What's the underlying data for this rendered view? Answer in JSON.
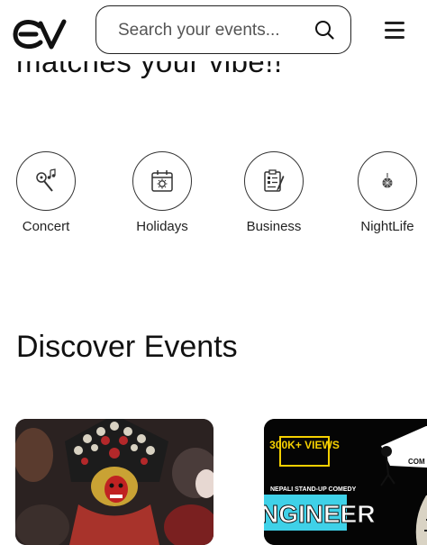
{
  "header": {
    "logo_text": "EV",
    "search": {
      "placeholder": "Search your events...",
      "value": ""
    },
    "icons": {
      "search": "search-icon",
      "menu": "hamburger-menu-icon"
    }
  },
  "hero": {
    "text": "matches your vibe!!"
  },
  "categories": [
    {
      "label": "Concert",
      "icon": "guitar-music-icon"
    },
    {
      "label": "Holidays",
      "icon": "calendar-sun-icon"
    },
    {
      "label": "Business",
      "icon": "clipboard-checklist-icon"
    },
    {
      "label": "NightLife",
      "icon": "disco-ball-icon"
    }
  ],
  "discover": {
    "title": "Discover Events",
    "cards": [
      {
        "image": "festival-mask-photo"
      },
      {
        "image": "standup-comedy-poster",
        "badge": "300K+ VIEWS",
        "tagline": "NEPALI STAND-UP COMEDY",
        "title_fragment": "NGINEER",
        "sticker": "COM"
      }
    ]
  },
  "colors": {
    "text": "#111111",
    "border": "#222222",
    "poster_accent": "#f5d000",
    "poster_cyan": "#3fd1e8"
  }
}
